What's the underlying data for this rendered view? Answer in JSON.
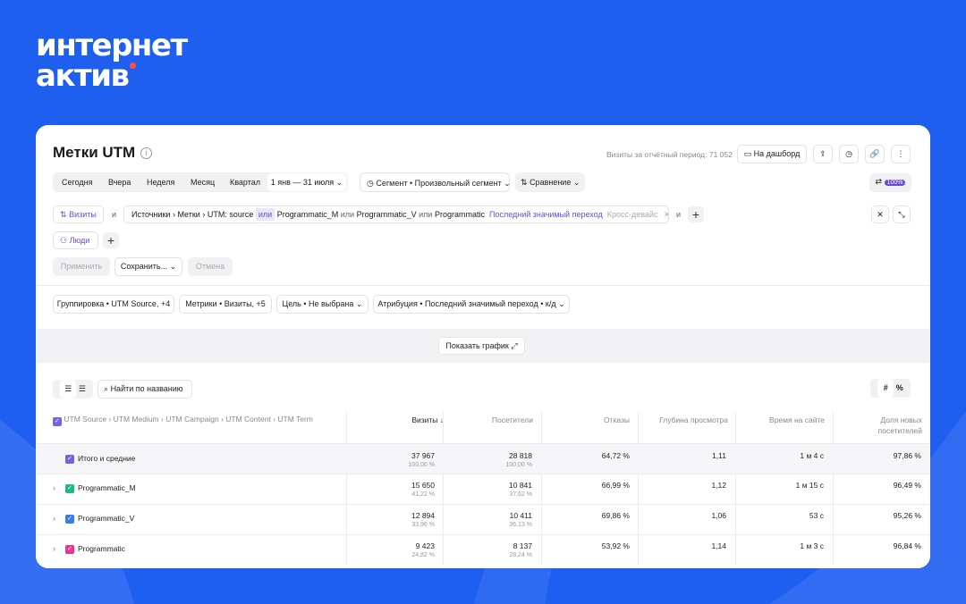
{
  "brand": {
    "line1": "интернет",
    "line2": "актив",
    "colors": {
      "background": "#1f5ff0",
      "accent": "#ff4f3b",
      "purple": "#6b4bd6"
    }
  },
  "header": {
    "title": "Метки UTM",
    "visits_period": "Визиты за отчётный период: 71 052",
    "dashboard_button": "На дашборд"
  },
  "period": {
    "items": [
      "Сегодня",
      "Вчера",
      "Неделя",
      "Месяц",
      "Квартал"
    ],
    "range": "1 янв — 31 июля",
    "segment": "Сегмент • Произвольный сегмент",
    "comparison": "Сравнение",
    "sampling": "100%"
  },
  "filters": {
    "visits_label": "Визиты",
    "and1": "и",
    "path": "Источники › Метки › UTM: source",
    "or": "или",
    "val1": "Programmatic_M",
    "or2": "или",
    "val2": "Programmatic_V",
    "or3": "или",
    "val3": "Programmatic",
    "attribution": "Последний значимый переход",
    "cross_device": "Кросс-девайс",
    "and2": "и",
    "people_label": "Люди"
  },
  "actions": {
    "apply": "Применить",
    "save": "Сохранить...",
    "cancel": "Отмена"
  },
  "settings": {
    "grouping": "Группировка • UTM Source, +4",
    "metrics": "Метрики • Визиты, +5",
    "goal": "Цель • Не выбрана",
    "attribution": "Атрибуция • Последний значимый переход • к/д"
  },
  "chart_toggle": "Показать график",
  "table": {
    "search_placeholder": "Найти по названию",
    "hash_toggle": "#",
    "percent_toggle": "%",
    "dimension_header": "UTM Source › UTM Medium › UTM Campaign › UTM Content › UTM Term",
    "columns": [
      "Визиты ↓",
      "Посетители",
      "Отказы",
      "Глубина просмотра",
      "Время на сайте",
      "Доля новых посетителей"
    ],
    "rows": [
      {
        "name": "Итого и средние",
        "visits": "37 967",
        "visits_pct": "100,00 %",
        "visitors": "28 818",
        "visitors_pct": "100,00 %",
        "bounce": "64,72 %",
        "depth": "1,11",
        "time": "1 м 4 с",
        "new": "97,86 %",
        "color": "#7b61e0"
      },
      {
        "name": "Programmatic_M",
        "visits": "15 650",
        "visits_pct": "41,22 %",
        "visitors": "10 841",
        "visitors_pct": "37,62 %",
        "bounce": "66,99 %",
        "depth": "1,12",
        "time": "1 м 15 с",
        "new": "96,49 %",
        "color": "#1fb88a"
      },
      {
        "name": "Programmatic_V",
        "visits": "12 894",
        "visits_pct": "33,96 %",
        "visitors": "10 411",
        "visitors_pct": "36,13 %",
        "bounce": "69,86 %",
        "depth": "1,06",
        "time": "53 с",
        "new": "95,26 %",
        "color": "#3b7de8"
      },
      {
        "name": "Programmatic",
        "visits": "9 423",
        "visits_pct": "24,82 %",
        "visitors": "8 137",
        "visitors_pct": "28,24 %",
        "bounce": "53,92 %",
        "depth": "1,14",
        "time": "1 м 3 с",
        "new": "96,84 %",
        "color": "#e8368f"
      }
    ]
  }
}
